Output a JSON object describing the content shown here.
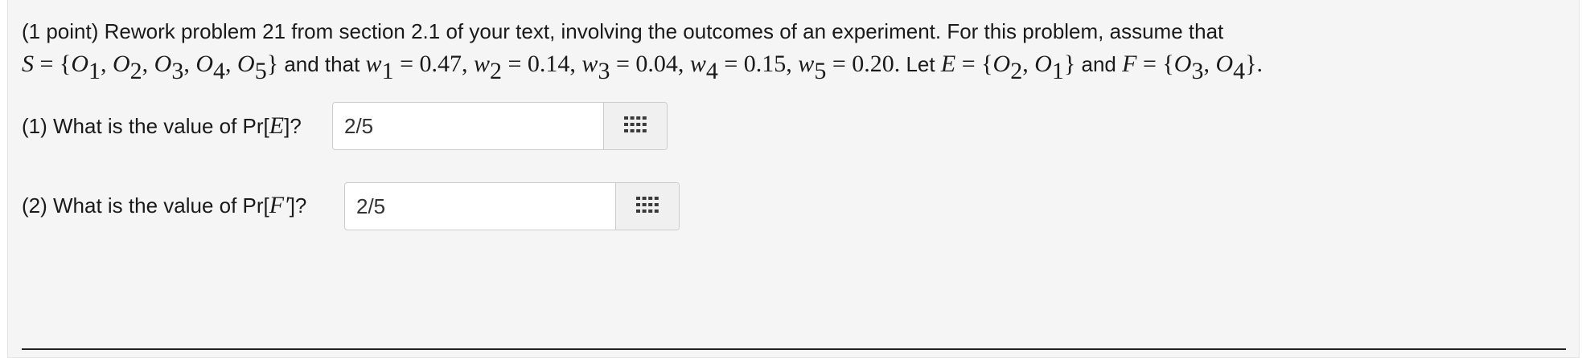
{
  "problem": {
    "prefix": "(1 point) Rework problem 21 from section 2.1 of your text, involving the outcomes of an experiment. For this problem, assume that",
    "and_that": "and that",
    "let": "Let",
    "and": "and",
    "period": "."
  },
  "questions": [
    {
      "label_before": "(1) What is the value of Pr[",
      "variable": "E",
      "label_after": "]?",
      "value": "2/5"
    },
    {
      "label_before": "(2) What is the value of Pr[",
      "variable": "F′",
      "label_after": "]?",
      "value": "2/5"
    }
  ],
  "icons": {
    "answer_tool": "keypad-grid-icon"
  }
}
